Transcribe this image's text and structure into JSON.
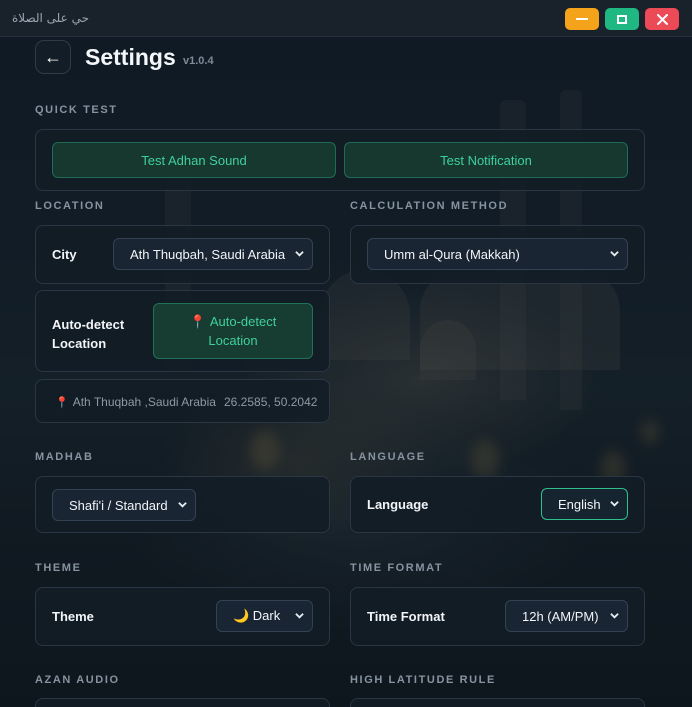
{
  "window": {
    "title": "حي على الصلاة"
  },
  "header": {
    "back_icon": "←",
    "title": "Settings",
    "version": "v1.0.4"
  },
  "quick_test": {
    "label": "QUICK TEST",
    "test_adhan_label": "Test Adhan Sound",
    "test_notification_label": "Test Notification"
  },
  "location": {
    "label": "LOCATION",
    "city_label": "City",
    "city_value": "Ath Thuqbah, Saudi Arabia",
    "autodetect_label_line1": "Auto-detect",
    "autodetect_label_line2": "Location",
    "autodetect_button_line1": "Auto-detect",
    "autodetect_button_line2": "Location",
    "current_location": "Ath Thuqbah ,Saudi Arabia",
    "coordinates": "26.2585, 50.2042"
  },
  "calculation": {
    "label": "CALCULATION METHOD",
    "value": "Umm al-Qura (Makkah)"
  },
  "madhab": {
    "label": "MADHAB",
    "value": "Shafi'i / Standard"
  },
  "language": {
    "label": "LANGUAGE",
    "field_label": "Language",
    "value": "English"
  },
  "theme": {
    "label": "THEME",
    "field_label": "Theme",
    "value": "🌙 Dark"
  },
  "time_format": {
    "label": "TIME FORMAT",
    "field_label": "Time Format",
    "value": "12h (AM/PM)"
  },
  "azan_audio": {
    "label": "AZAN AUDIO"
  },
  "high_latitude": {
    "label": "HIGH LATITUDE RULE"
  },
  "colors": {
    "accent": "#3fd19c",
    "minimize": "#f5a31a",
    "maximize": "#1fb883",
    "close": "#ec4a57"
  }
}
